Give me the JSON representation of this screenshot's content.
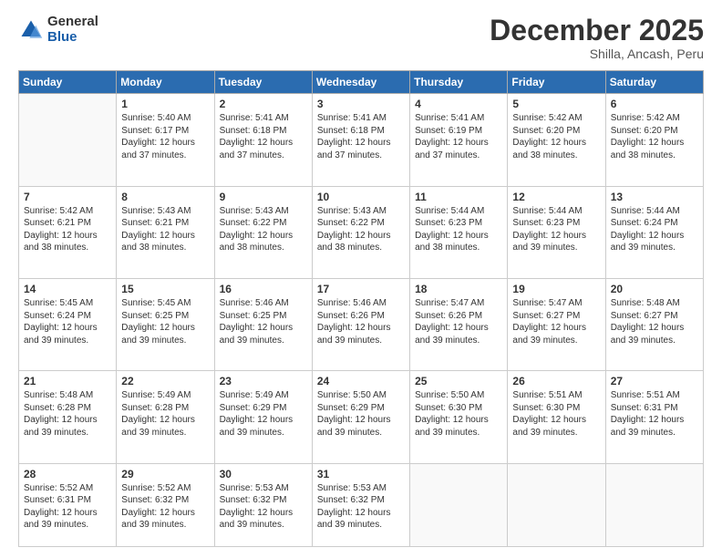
{
  "header": {
    "logo": {
      "general": "General",
      "blue": "Blue"
    },
    "title": "December 2025",
    "subtitle": "Shilla, Ancash, Peru"
  },
  "weekdays": [
    "Sunday",
    "Monday",
    "Tuesday",
    "Wednesday",
    "Thursday",
    "Friday",
    "Saturday"
  ],
  "weeks": [
    [
      {
        "day": "",
        "info": ""
      },
      {
        "day": "1",
        "info": "Sunrise: 5:40 AM\nSunset: 6:17 PM\nDaylight: 12 hours\nand 37 minutes."
      },
      {
        "day": "2",
        "info": "Sunrise: 5:41 AM\nSunset: 6:18 PM\nDaylight: 12 hours\nand 37 minutes."
      },
      {
        "day": "3",
        "info": "Sunrise: 5:41 AM\nSunset: 6:18 PM\nDaylight: 12 hours\nand 37 minutes."
      },
      {
        "day": "4",
        "info": "Sunrise: 5:41 AM\nSunset: 6:19 PM\nDaylight: 12 hours\nand 37 minutes."
      },
      {
        "day": "5",
        "info": "Sunrise: 5:42 AM\nSunset: 6:20 PM\nDaylight: 12 hours\nand 38 minutes."
      },
      {
        "day": "6",
        "info": "Sunrise: 5:42 AM\nSunset: 6:20 PM\nDaylight: 12 hours\nand 38 minutes."
      }
    ],
    [
      {
        "day": "7",
        "info": "Sunrise: 5:42 AM\nSunset: 6:21 PM\nDaylight: 12 hours\nand 38 minutes."
      },
      {
        "day": "8",
        "info": "Sunrise: 5:43 AM\nSunset: 6:21 PM\nDaylight: 12 hours\nand 38 minutes."
      },
      {
        "day": "9",
        "info": "Sunrise: 5:43 AM\nSunset: 6:22 PM\nDaylight: 12 hours\nand 38 minutes."
      },
      {
        "day": "10",
        "info": "Sunrise: 5:43 AM\nSunset: 6:22 PM\nDaylight: 12 hours\nand 38 minutes."
      },
      {
        "day": "11",
        "info": "Sunrise: 5:44 AM\nSunset: 6:23 PM\nDaylight: 12 hours\nand 38 minutes."
      },
      {
        "day": "12",
        "info": "Sunrise: 5:44 AM\nSunset: 6:23 PM\nDaylight: 12 hours\nand 39 minutes."
      },
      {
        "day": "13",
        "info": "Sunrise: 5:44 AM\nSunset: 6:24 PM\nDaylight: 12 hours\nand 39 minutes."
      }
    ],
    [
      {
        "day": "14",
        "info": "Sunrise: 5:45 AM\nSunset: 6:24 PM\nDaylight: 12 hours\nand 39 minutes."
      },
      {
        "day": "15",
        "info": "Sunrise: 5:45 AM\nSunset: 6:25 PM\nDaylight: 12 hours\nand 39 minutes."
      },
      {
        "day": "16",
        "info": "Sunrise: 5:46 AM\nSunset: 6:25 PM\nDaylight: 12 hours\nand 39 minutes."
      },
      {
        "day": "17",
        "info": "Sunrise: 5:46 AM\nSunset: 6:26 PM\nDaylight: 12 hours\nand 39 minutes."
      },
      {
        "day": "18",
        "info": "Sunrise: 5:47 AM\nSunset: 6:26 PM\nDaylight: 12 hours\nand 39 minutes."
      },
      {
        "day": "19",
        "info": "Sunrise: 5:47 AM\nSunset: 6:27 PM\nDaylight: 12 hours\nand 39 minutes."
      },
      {
        "day": "20",
        "info": "Sunrise: 5:48 AM\nSunset: 6:27 PM\nDaylight: 12 hours\nand 39 minutes."
      }
    ],
    [
      {
        "day": "21",
        "info": "Sunrise: 5:48 AM\nSunset: 6:28 PM\nDaylight: 12 hours\nand 39 minutes."
      },
      {
        "day": "22",
        "info": "Sunrise: 5:49 AM\nSunset: 6:28 PM\nDaylight: 12 hours\nand 39 minutes."
      },
      {
        "day": "23",
        "info": "Sunrise: 5:49 AM\nSunset: 6:29 PM\nDaylight: 12 hours\nand 39 minutes."
      },
      {
        "day": "24",
        "info": "Sunrise: 5:50 AM\nSunset: 6:29 PM\nDaylight: 12 hours\nand 39 minutes."
      },
      {
        "day": "25",
        "info": "Sunrise: 5:50 AM\nSunset: 6:30 PM\nDaylight: 12 hours\nand 39 minutes."
      },
      {
        "day": "26",
        "info": "Sunrise: 5:51 AM\nSunset: 6:30 PM\nDaylight: 12 hours\nand 39 minutes."
      },
      {
        "day": "27",
        "info": "Sunrise: 5:51 AM\nSunset: 6:31 PM\nDaylight: 12 hours\nand 39 minutes."
      }
    ],
    [
      {
        "day": "28",
        "info": "Sunrise: 5:52 AM\nSunset: 6:31 PM\nDaylight: 12 hours\nand 39 minutes."
      },
      {
        "day": "29",
        "info": "Sunrise: 5:52 AM\nSunset: 6:32 PM\nDaylight: 12 hours\nand 39 minutes."
      },
      {
        "day": "30",
        "info": "Sunrise: 5:53 AM\nSunset: 6:32 PM\nDaylight: 12 hours\nand 39 minutes."
      },
      {
        "day": "31",
        "info": "Sunrise: 5:53 AM\nSunset: 6:32 PM\nDaylight: 12 hours\nand 39 minutes."
      },
      {
        "day": "",
        "info": ""
      },
      {
        "day": "",
        "info": ""
      },
      {
        "day": "",
        "info": ""
      }
    ]
  ]
}
